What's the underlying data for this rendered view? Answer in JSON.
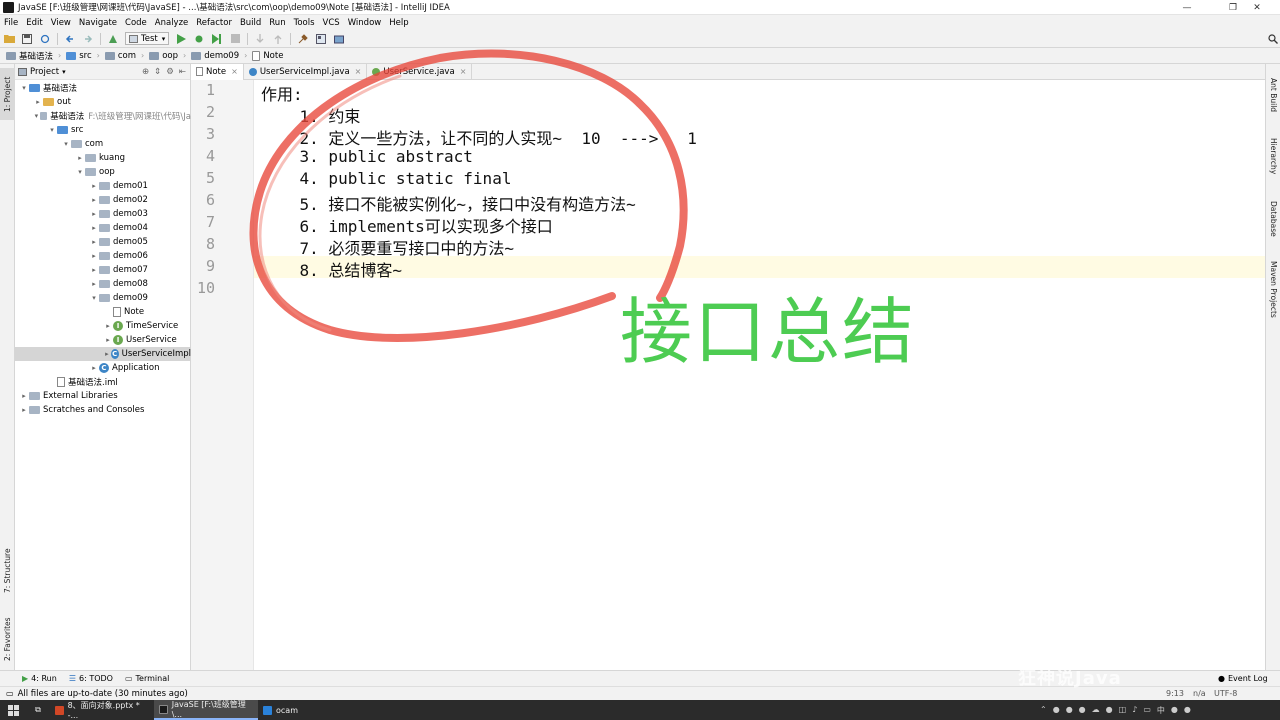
{
  "window": {
    "title": "JavaSE [F:\\班级管理\\网课班\\代码\\JavaSE] - ...\\基础语法\\src\\com\\oop\\demo09\\Note [基础语法] - IntelliJ IDEA",
    "minimize": "—",
    "maximize": "❐",
    "close": "✕"
  },
  "menu": [
    "File",
    "Edit",
    "View",
    "Navigate",
    "Code",
    "Analyze",
    "Refactor",
    "Build",
    "Run",
    "Tools",
    "VCS",
    "Window",
    "Help"
  ],
  "toolbar": {
    "run_config": "Test"
  },
  "breadcrumb": [
    "基础语法",
    "src",
    "com",
    "oop",
    "demo09",
    "Note"
  ],
  "left_strip": {
    "project": "1: Project",
    "structure": "7: Structure",
    "favorites": "2: Favorites"
  },
  "project_panel": {
    "header": "Project",
    "tree": [
      {
        "label": "基础语法",
        "extra": "",
        "icon": "folder-b",
        "arrow": "▾",
        "indent": 0
      },
      {
        "label": "out",
        "extra": "",
        "icon": "folder-o",
        "arrow": "▸",
        "indent": 1
      },
      {
        "label": "基础语法",
        "extra": "F:\\班级管理\\网课班\\代码\\Ja",
        "icon": "folder",
        "arrow": "▾",
        "indent": 1
      },
      {
        "label": "src",
        "extra": "",
        "icon": "folder-b",
        "arrow": "▾",
        "indent": 2
      },
      {
        "label": "com",
        "extra": "",
        "icon": "folder",
        "arrow": "▾",
        "indent": 3
      },
      {
        "label": "kuang",
        "extra": "",
        "icon": "folder",
        "arrow": "▸",
        "indent": 4
      },
      {
        "label": "oop",
        "extra": "",
        "icon": "folder",
        "arrow": "▾",
        "indent": 4
      },
      {
        "label": "demo01",
        "extra": "",
        "icon": "folder",
        "arrow": "▸",
        "indent": 5
      },
      {
        "label": "demo02",
        "extra": "",
        "icon": "folder",
        "arrow": "▸",
        "indent": 5
      },
      {
        "label": "demo03",
        "extra": "",
        "icon": "folder",
        "arrow": "▸",
        "indent": 5
      },
      {
        "label": "demo04",
        "extra": "",
        "icon": "folder",
        "arrow": "▸",
        "indent": 5
      },
      {
        "label": "demo05",
        "extra": "",
        "icon": "folder",
        "arrow": "▸",
        "indent": 5
      },
      {
        "label": "demo06",
        "extra": "",
        "icon": "folder",
        "arrow": "▸",
        "indent": 5
      },
      {
        "label": "demo07",
        "extra": "",
        "icon": "folder",
        "arrow": "▸",
        "indent": 5
      },
      {
        "label": "demo08",
        "extra": "",
        "icon": "folder",
        "arrow": "▸",
        "indent": 5
      },
      {
        "label": "demo09",
        "extra": "",
        "icon": "folder",
        "arrow": "▾",
        "indent": 5
      },
      {
        "label": "Note",
        "extra": "",
        "icon": "file",
        "arrow": "",
        "indent": 6
      },
      {
        "label": "TimeService",
        "extra": "",
        "icon": "iface",
        "arrow": "▸",
        "indent": 6
      },
      {
        "label": "UserService",
        "extra": "",
        "icon": "iface",
        "arrow": "▸",
        "indent": 6
      },
      {
        "label": "UserServiceImpl",
        "extra": "",
        "icon": "cls",
        "arrow": "▸",
        "indent": 6,
        "selected": true
      },
      {
        "label": "Application",
        "extra": "",
        "icon": "cls",
        "arrow": "▸",
        "indent": 5
      },
      {
        "label": "基础语法.iml",
        "extra": "",
        "icon": "file",
        "arrow": "",
        "indent": 2
      },
      {
        "label": "External Libraries",
        "extra": "",
        "icon": "folder",
        "arrow": "▸",
        "indent": 0
      },
      {
        "label": "Scratches and Consoles",
        "extra": "",
        "icon": "folder",
        "arrow": "▸",
        "indent": 0
      }
    ]
  },
  "tabs": [
    {
      "label": "Note",
      "active": true,
      "color": "#888888"
    },
    {
      "label": "UserServiceImpl.java",
      "active": false,
      "color": "#3d85c6"
    },
    {
      "label": "UserService.java",
      "active": false,
      "color": "#6aa84f"
    }
  ],
  "editor": {
    "line_numbers": [
      "1",
      "2",
      "3",
      "4",
      "5",
      "6",
      "7",
      "8",
      "9",
      "10"
    ],
    "lines": [
      "作用:",
      "    1. 约束",
      "    2. 定义一些方法，让不同的人实现~  10  --->   1",
      "    3. public abstract",
      "    4. public static final",
      "    5. 接口不能被实例化~，接口中没有构造方法~",
      "    6. implements可以实现多个接口",
      "    7. 必须要重写接口中的方法~",
      "    8. 总结博客~",
      ""
    ]
  },
  "overlay": {
    "title": "接口总结",
    "title_color": "#4dcc52",
    "circle_color": "#e8473a"
  },
  "right_strip": [
    "Ant Build",
    "Hierarchy",
    "Database",
    "Maven Projects"
  ],
  "bottom_tabs": [
    {
      "label": "4: Run"
    },
    {
      "label": "6: TODO"
    },
    {
      "label": "Terminal"
    }
  ],
  "bottom_right": {
    "event_log": "Event Log"
  },
  "status": {
    "message": "All files are up-to-date (30 minutes ago)",
    "position": "9:13",
    "na": "n/a",
    "encoding": "UTF-8"
  },
  "taskbar": {
    "items": [
      {
        "label": "8、面向对象.pptx * -...",
        "color": "#d24726"
      },
      {
        "label": "JavaSE [F:\\班级管理\\...",
        "color": "#1a1a1a",
        "active": true
      },
      {
        "label": "ocam",
        "color": "#2a82da"
      }
    ],
    "ime": "中"
  },
  "watermark": "狂神说Java"
}
